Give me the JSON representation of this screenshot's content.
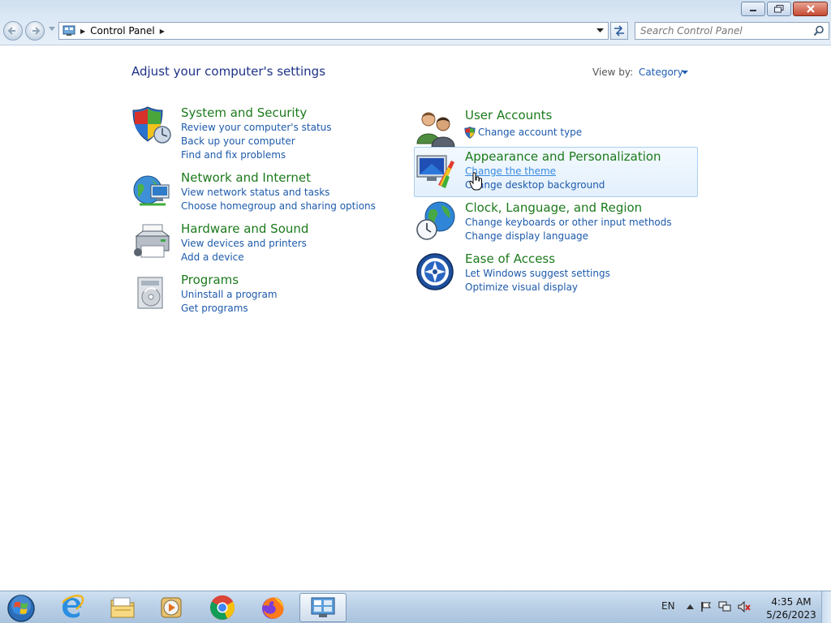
{
  "window": {
    "controls": [
      "minimize",
      "restore",
      "close"
    ]
  },
  "address_bar": {
    "breadcrumb": "Control Panel",
    "search_placeholder": "Search Control Panel"
  },
  "content": {
    "heading": "Adjust your computer's settings",
    "view_by_label": "View by:",
    "view_by_value": "Category",
    "categories_left": [
      {
        "title": "System and Security",
        "icon": "shield-icon",
        "links": [
          "Review your computer's status",
          "Back up your computer",
          "Find and fix problems"
        ]
      },
      {
        "title": "Network and Internet",
        "icon": "network-globe-icon",
        "links": [
          "View network status and tasks",
          "Choose homegroup and sharing options"
        ]
      },
      {
        "title": "Hardware and Sound",
        "icon": "printer-icon",
        "links": [
          "View devices and printers",
          "Add a device"
        ]
      },
      {
        "title": "Programs",
        "icon": "programs-icon",
        "links": [
          "Uninstall a program",
          "Get programs"
        ]
      }
    ],
    "categories_right": [
      {
        "title": "User Accounts",
        "icon": "users-icon",
        "links": [
          "Change account type"
        ]
      },
      {
        "title": "Appearance and Personalization",
        "icon": "display-paint-icon",
        "links": [
          "Change the theme",
          "Change desktop background"
        ]
      },
      {
        "title": "Clock, Language, and Region",
        "icon": "globe-clock-icon",
        "links": [
          "Change keyboards or other input methods",
          "Change display language"
        ]
      },
      {
        "title": "Ease of Access",
        "icon": "ease-of-access-icon",
        "links": [
          "Let Windows suggest settings",
          "Optimize visual display"
        ]
      }
    ]
  },
  "taskbar": {
    "apps": [
      "start-orb-icon",
      "internet-explorer-icon",
      "file-explorer-icon",
      "media-player-icon",
      "chrome-icon",
      "firefox-icon",
      "control-panel-icon"
    ],
    "language": "EN",
    "time": "4:35 AM",
    "date": "5/26/2023"
  },
  "colors": {
    "category_title": "#1c7a1c",
    "link": "#1d5aab",
    "heading": "#1e3287"
  }
}
